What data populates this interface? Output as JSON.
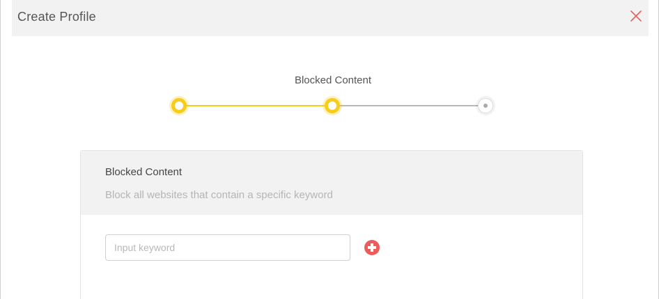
{
  "dialog": {
    "title": "Create Profile",
    "close_icon": "close-icon",
    "close_color": "#e5605c"
  },
  "stepper": {
    "current_label": "Blocked Content",
    "total_steps": 3,
    "current_step": 2,
    "active_color": "#f7cc1a",
    "inactive_color": "#b9b9b9"
  },
  "section": {
    "title": "Blocked Content",
    "description": "Block all websites that contain a specific keyword",
    "keyword_input": {
      "value": "",
      "placeholder": "Input keyword"
    },
    "add_icon": "plus-circle-icon",
    "add_color": "#ee5b5b"
  }
}
